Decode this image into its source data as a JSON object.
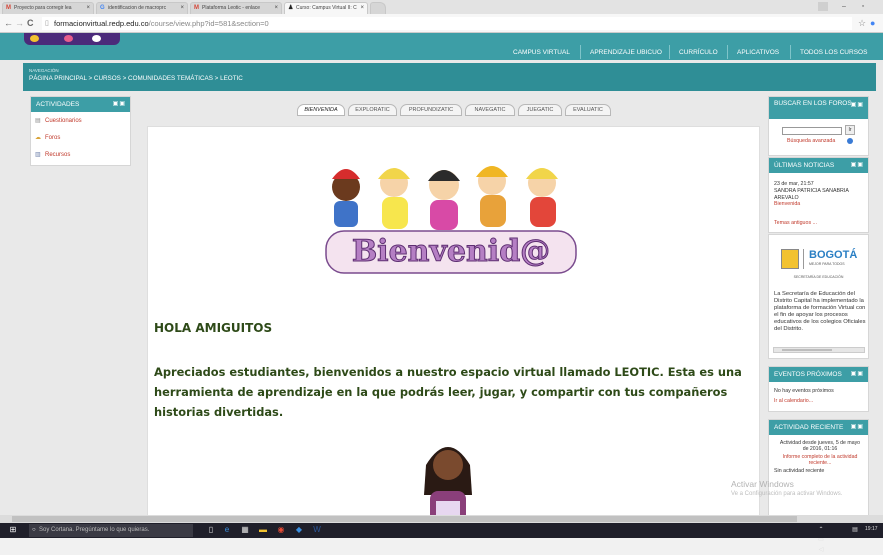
{
  "browser": {
    "tabs": [
      {
        "fav": "M",
        "fav_color": "#d44638",
        "label": "Proyecto para corregir lea"
      },
      {
        "fav": "G",
        "fav_color": "#4285f4",
        "label": "identificacion de macroprc"
      },
      {
        "fav": "M",
        "fav_color": "#d44638",
        "label": "Plataforma Leotic - enlace"
      },
      {
        "fav": "♟",
        "fav_color": "#222222",
        "label": "Curso: Campus Virtual II: C"
      }
    ],
    "url_host": "formacionvirtual.redp.edu.co",
    "url_path": "/course/view.php?id=581&section=0"
  },
  "topnav": {
    "items": [
      "CAMPUS VIRTUAL",
      "APRENDIZAJE UBICUO",
      "CURRÍCULO",
      "APLICATIVOS",
      "TODOS LOS CURSOS"
    ]
  },
  "breadcrumb": {
    "label": "NAVEGACIÓN",
    "trail": "PÁGINA PRINCIPAL > CURSOS > COMUNIDADES TEMÁTICAS > LEOTIC"
  },
  "actividades": {
    "title": "ACTIVIDADES",
    "items": [
      "Cuestionarios",
      "Foros",
      "Recursos"
    ]
  },
  "course_tabs": [
    "BIENVENIDA",
    "EXPLORATIC",
    "PROFUNDIZATIC",
    "NAVEGATIC",
    "JUEGATIC",
    "EVALUATIC"
  ],
  "content": {
    "banner_text": "Bienvenid@",
    "heading": "HOLA AMIGUITOS",
    "paragraph": "Apreciados estudiantes, bienvenidos a nuestro espacio virtual llamado LEOTIC. Esta es una herramienta de aprendizaje en la que podrás leer, jugar, y compartir con tus compañeros historias divertidas."
  },
  "buscar": {
    "title": "BUSCAR EN LOS FOROS",
    "button": "Ir",
    "advanced": "Búsqueda avanzada"
  },
  "noticias": {
    "title": "ÚLTIMAS NOTICIAS",
    "date": "23 de mar, 21:57",
    "author": "SANDRA PATRICIA SANABRIA AREVALO",
    "post": "Bienvenida",
    "older": "Temas antiguos ..."
  },
  "bogota": {
    "logo_small": "BOGOTÁ",
    "logo_tag": "MEJOR PARA TODOS",
    "dept": "SECRETARÍA DE EDUCACIÓN",
    "text": "La Secretaría de Educación del Distrito Capital ha implementado la plataforma de formación Virtual con el fin de apoyar los procesos educativos de los colegios Oficiales del Distrito."
  },
  "eventos": {
    "title": "EVENTOS PRÓXIMOS",
    "none": "No hay eventos próximos",
    "calendar": "Ir al calendario..."
  },
  "reciente": {
    "title": "ACTIVIDAD RECIENTE",
    "since": "Actividad desde jueves, 5 de mayo de 2016, 01:16",
    "report": "Informe completo de la actividad reciente...",
    "none": "Sin actividad reciente"
  },
  "watermark": {
    "line1": "Activar Windows",
    "line2": "Ve a Configuración para activar Windows."
  },
  "taskbar": {
    "cortana": "Soy Cortana. Pregúntame lo que quieras.",
    "time": "19:17"
  }
}
